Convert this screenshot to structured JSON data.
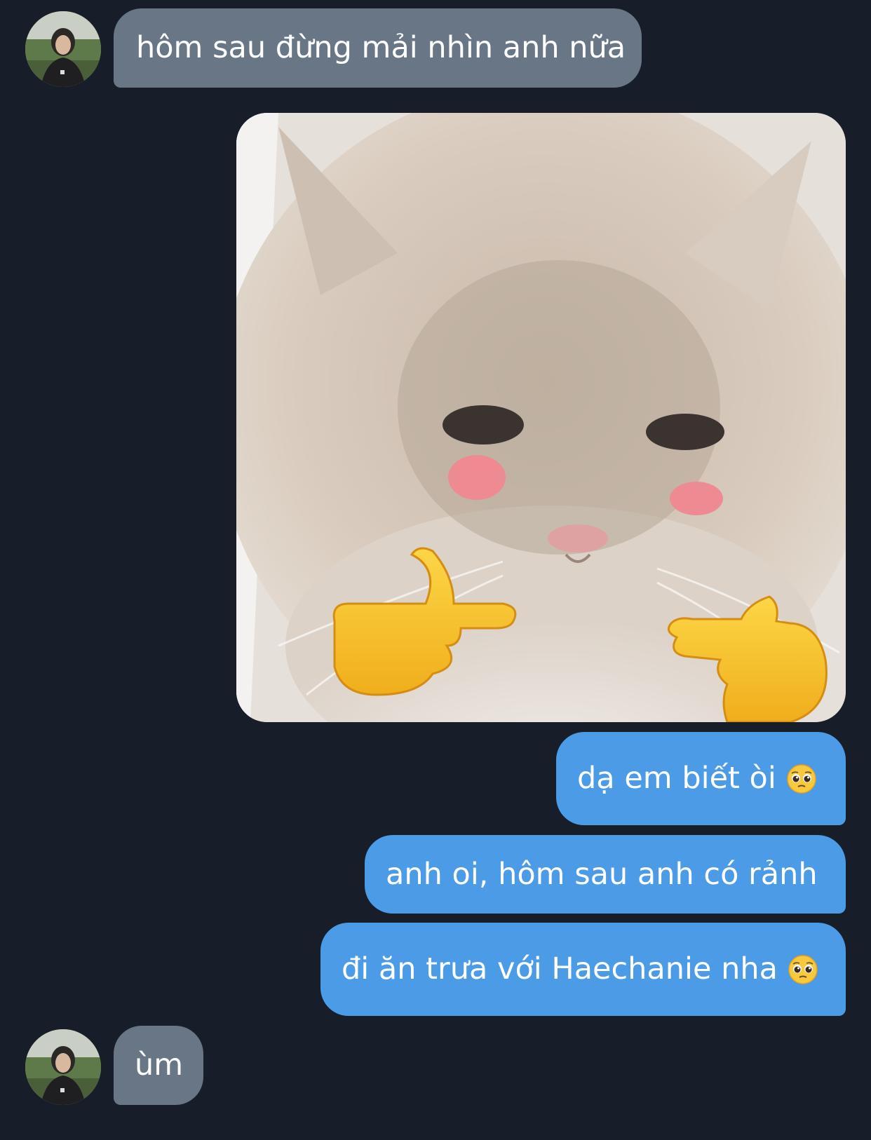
{
  "chat": {
    "messages": [
      {
        "direction": "incoming",
        "text": "hôm sau đừng mải nhìn anh nữa"
      },
      {
        "direction": "outgoing",
        "kind": "image",
        "icon": "cat-pointing-fingers-sticker"
      },
      {
        "direction": "outgoing",
        "text": "dạ em biết òi",
        "emoji": "pleading-face-icon"
      },
      {
        "direction": "outgoing",
        "text": "anh oi, hôm sau anh có rảnh"
      },
      {
        "direction": "outgoing",
        "text": "đi ăn trưa với Haechanie nha",
        "emoji": "pleading-face-icon"
      },
      {
        "direction": "incoming",
        "text": "ùm"
      }
    ]
  },
  "colors": {
    "background": "#171e29",
    "incoming_bubble": "#687685",
    "outgoing_bubble": "#4b9be6",
    "text": "#ffffff"
  }
}
